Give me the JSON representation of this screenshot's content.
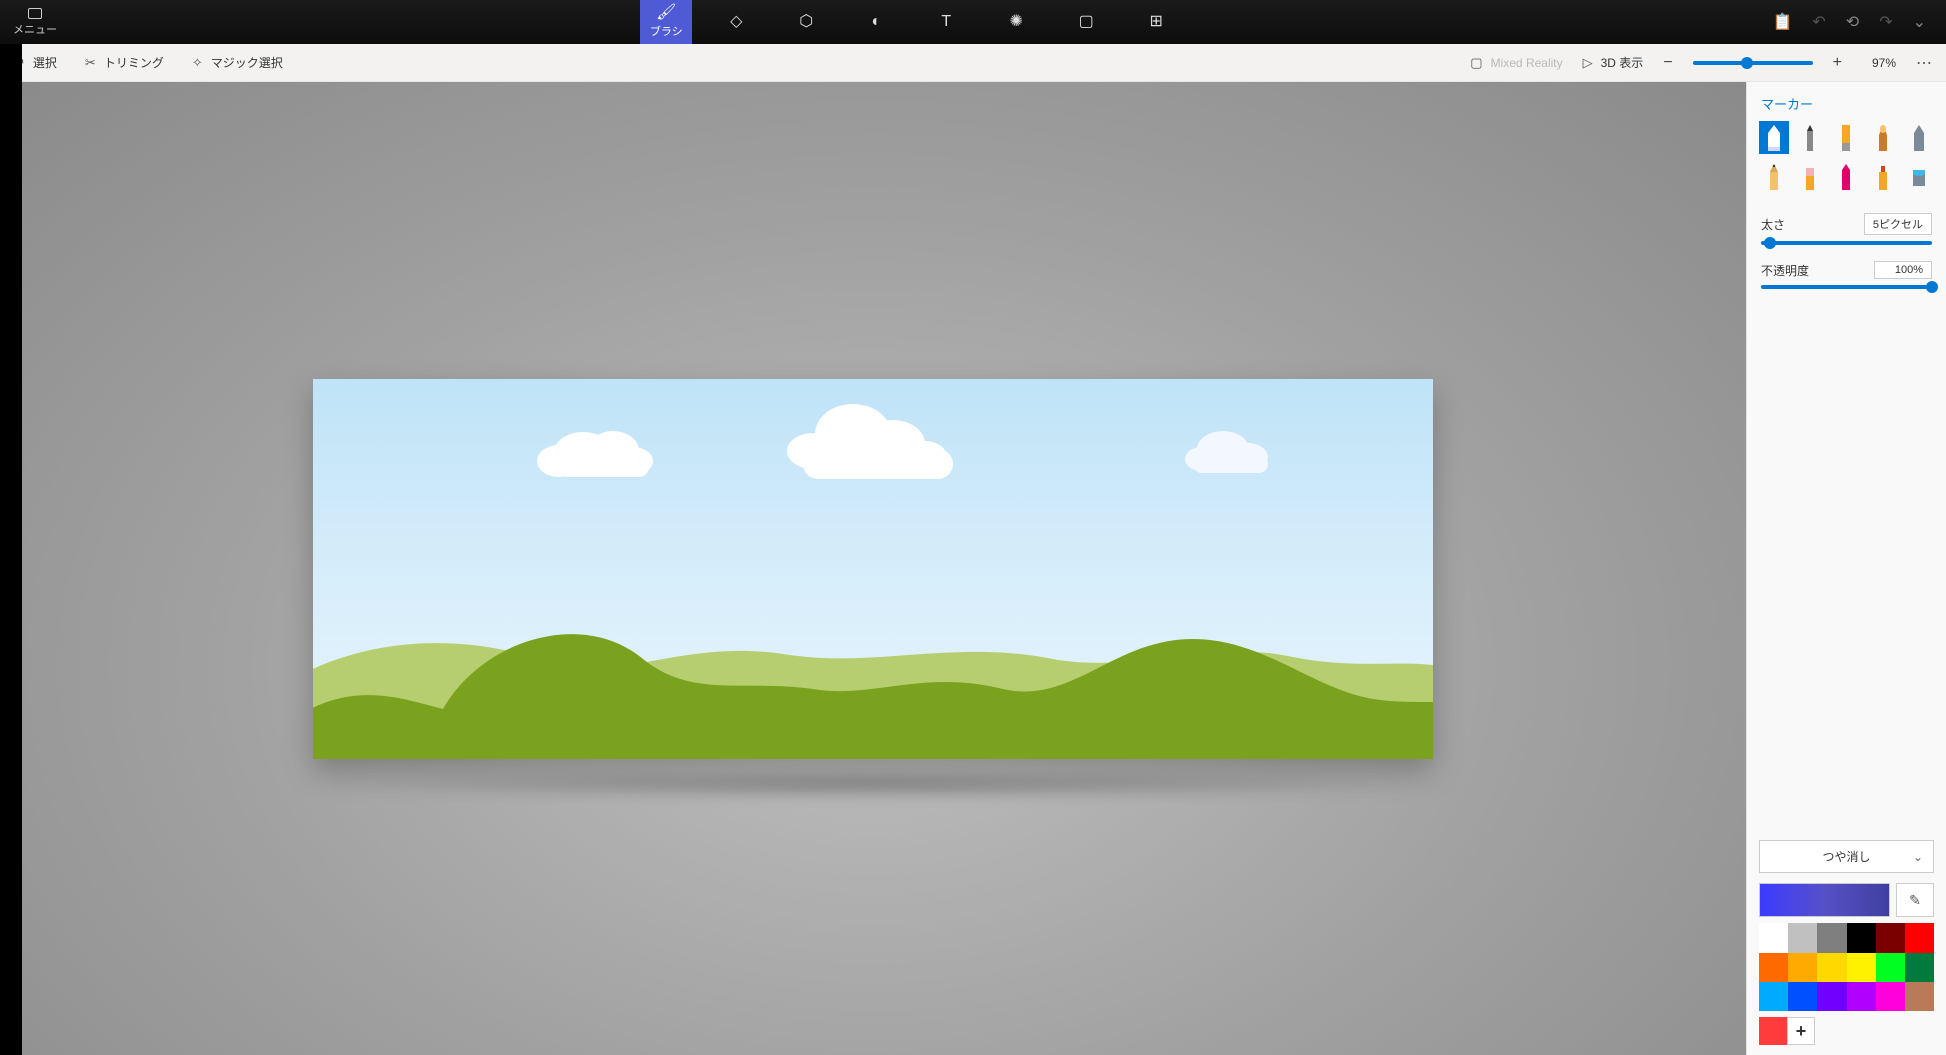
{
  "topbar": {
    "menu_label": "メニュー",
    "selected_tool_label": "ブラシ"
  },
  "subbar": {
    "select_label": "選択",
    "crop_label": "トリミング",
    "magic_label": "マジック選択",
    "mixed_reality_label": "Mixed Reality",
    "view3d_label": "3D 表示",
    "zoom_pct": "97%"
  },
  "panel": {
    "header": "マーカー",
    "thickness_label": "太さ",
    "thickness_value": "5ピクセル",
    "thickness_pos_pct": 5,
    "opacity_label": "不透明度",
    "opacity_value": "100%",
    "opacity_pos_pct": 100,
    "material_label": "つや消し",
    "palette": [
      "#ffffff",
      "#c0c0c0",
      "#7f7f7f",
      "#000000",
      "#7a0000",
      "#ff0000",
      "#ff6a00",
      "#ffaa00",
      "#ffd800",
      "#fff200",
      "#00ff21",
      "#007a3d",
      "#00aaff",
      "#0050ff",
      "#7200ff",
      "#b200ff",
      "#ff00dc",
      "#b97a57"
    ],
    "add_swatch": "#ff3b3b"
  }
}
